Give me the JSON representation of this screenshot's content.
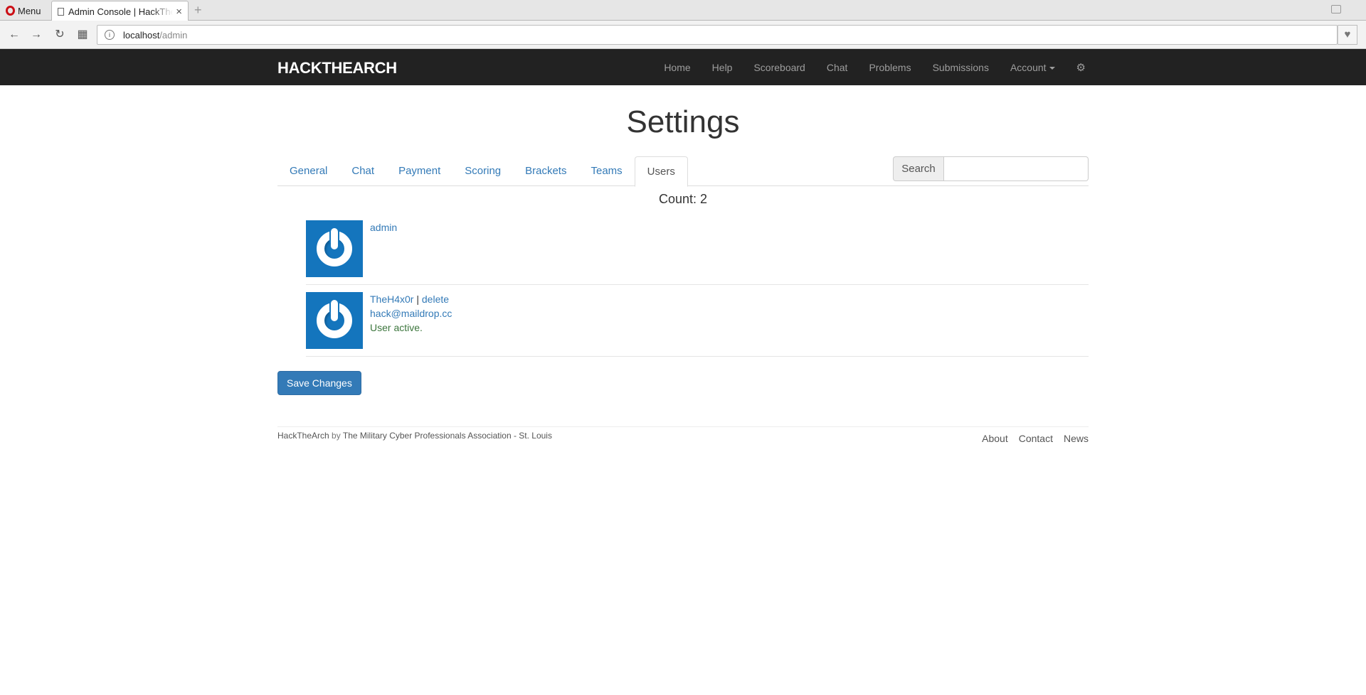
{
  "browser": {
    "menu_label": "Menu",
    "tab_title": "Admin Console | HackTheArch",
    "tab_close": "×",
    "new_tab": "+",
    "url_host": "localhost",
    "url_path": "/admin"
  },
  "navbar": {
    "brand": "HACKTHEARCH",
    "links": [
      "Home",
      "Help",
      "Scoreboard",
      "Chat",
      "Problems",
      "Submissions"
    ],
    "account_label": "Account"
  },
  "page": {
    "title": "Settings",
    "tabs": [
      "General",
      "Chat",
      "Payment",
      "Scoring",
      "Brackets",
      "Teams",
      "Users"
    ],
    "active_tab": "Users",
    "search_label": "Search",
    "search_value": "",
    "count_text": "Count: 2"
  },
  "users": [
    {
      "username": "admin"
    },
    {
      "username": "TheH4x0r",
      "separator": "|",
      "delete_label": "delete",
      "email": "hack@maildrop.cc",
      "status": "User active."
    }
  ],
  "actions": {
    "save_label": "Save Changes"
  },
  "footer": {
    "brand": "HackTheArch",
    "by": "by",
    "org": "The Military Cyber Professionals Association - St. Louis",
    "links": [
      "About",
      "Contact",
      "News"
    ]
  },
  "colors": {
    "navbar_bg": "#222222",
    "link": "#337ab7",
    "primary_button": "#337ab7",
    "success_text": "#3c763d",
    "avatar_bg": "#1475bd"
  }
}
